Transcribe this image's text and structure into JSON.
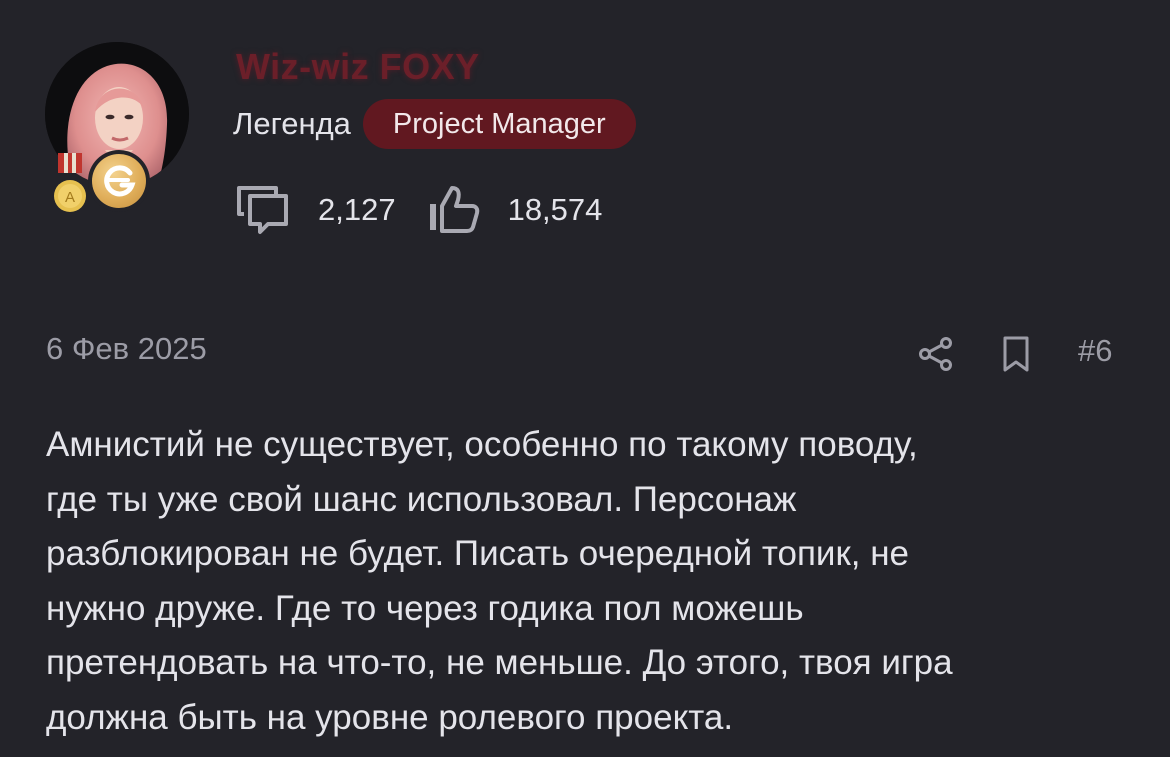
{
  "user": {
    "username": "Wiz-wiz FOXY",
    "rank": "Легенда",
    "role": "Project Manager",
    "badges": [
      {
        "icon": "medal-icon",
        "letter": "A"
      },
      {
        "icon": "g-logo-badge-icon",
        "letter": "G"
      }
    ],
    "avatar_icon": "avatar-pink-hair-portrait"
  },
  "stats": {
    "messages_icon": "messages-icon",
    "messages": "2,127",
    "reactions_icon": "thumbs-up-icon",
    "reactions": "18,574"
  },
  "meta": {
    "date": "6 Фев 2025",
    "share_icon": "share-icon",
    "bookmark_icon": "bookmark-icon",
    "post_number": "#6"
  },
  "post": {
    "lines": [
      "Амнистий не существует, особенно по такому поводу,",
      "где ты уже свой шанс использовал. Персонаж",
      "разблокирован не будет. Писать очередной топик, не",
      "нужно друже. Где то через годика пол можешь",
      "претендовать на что-то, не меньше. До этого, твоя игра",
      "должна быть на уровне ролевого проекта."
    ]
  },
  "colors": {
    "background": "#232329",
    "username": "#6b1f29",
    "role_badge_bg": "#611820",
    "muted_text": "#9c9ca6",
    "text": "#e4e4ea",
    "gold": "#e0ae5a"
  }
}
